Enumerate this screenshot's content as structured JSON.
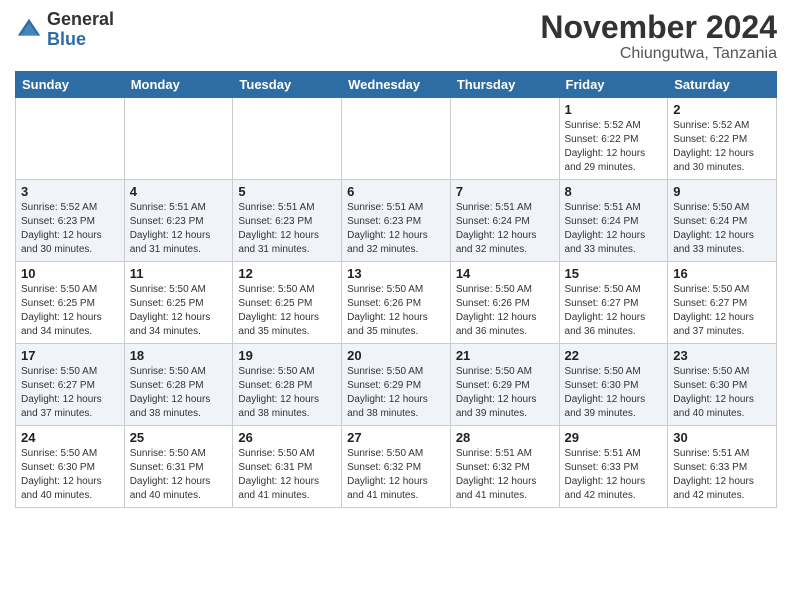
{
  "header": {
    "logo_line1": "General",
    "logo_line2": "Blue",
    "month": "November 2024",
    "location": "Chiungutwa, Tanzania"
  },
  "weekdays": [
    "Sunday",
    "Monday",
    "Tuesday",
    "Wednesday",
    "Thursday",
    "Friday",
    "Saturday"
  ],
  "weeks": [
    [
      {
        "day": "",
        "info": ""
      },
      {
        "day": "",
        "info": ""
      },
      {
        "day": "",
        "info": ""
      },
      {
        "day": "",
        "info": ""
      },
      {
        "day": "",
        "info": ""
      },
      {
        "day": "1",
        "info": "Sunrise: 5:52 AM\nSunset: 6:22 PM\nDaylight: 12 hours\nand 29 minutes."
      },
      {
        "day": "2",
        "info": "Sunrise: 5:52 AM\nSunset: 6:22 PM\nDaylight: 12 hours\nand 30 minutes."
      }
    ],
    [
      {
        "day": "3",
        "info": "Sunrise: 5:52 AM\nSunset: 6:23 PM\nDaylight: 12 hours\nand 30 minutes."
      },
      {
        "day": "4",
        "info": "Sunrise: 5:51 AM\nSunset: 6:23 PM\nDaylight: 12 hours\nand 31 minutes."
      },
      {
        "day": "5",
        "info": "Sunrise: 5:51 AM\nSunset: 6:23 PM\nDaylight: 12 hours\nand 31 minutes."
      },
      {
        "day": "6",
        "info": "Sunrise: 5:51 AM\nSunset: 6:23 PM\nDaylight: 12 hours\nand 32 minutes."
      },
      {
        "day": "7",
        "info": "Sunrise: 5:51 AM\nSunset: 6:24 PM\nDaylight: 12 hours\nand 32 minutes."
      },
      {
        "day": "8",
        "info": "Sunrise: 5:51 AM\nSunset: 6:24 PM\nDaylight: 12 hours\nand 33 minutes."
      },
      {
        "day": "9",
        "info": "Sunrise: 5:50 AM\nSunset: 6:24 PM\nDaylight: 12 hours\nand 33 minutes."
      }
    ],
    [
      {
        "day": "10",
        "info": "Sunrise: 5:50 AM\nSunset: 6:25 PM\nDaylight: 12 hours\nand 34 minutes."
      },
      {
        "day": "11",
        "info": "Sunrise: 5:50 AM\nSunset: 6:25 PM\nDaylight: 12 hours\nand 34 minutes."
      },
      {
        "day": "12",
        "info": "Sunrise: 5:50 AM\nSunset: 6:25 PM\nDaylight: 12 hours\nand 35 minutes."
      },
      {
        "day": "13",
        "info": "Sunrise: 5:50 AM\nSunset: 6:26 PM\nDaylight: 12 hours\nand 35 minutes."
      },
      {
        "day": "14",
        "info": "Sunrise: 5:50 AM\nSunset: 6:26 PM\nDaylight: 12 hours\nand 36 minutes."
      },
      {
        "day": "15",
        "info": "Sunrise: 5:50 AM\nSunset: 6:27 PM\nDaylight: 12 hours\nand 36 minutes."
      },
      {
        "day": "16",
        "info": "Sunrise: 5:50 AM\nSunset: 6:27 PM\nDaylight: 12 hours\nand 37 minutes."
      }
    ],
    [
      {
        "day": "17",
        "info": "Sunrise: 5:50 AM\nSunset: 6:27 PM\nDaylight: 12 hours\nand 37 minutes."
      },
      {
        "day": "18",
        "info": "Sunrise: 5:50 AM\nSunset: 6:28 PM\nDaylight: 12 hours\nand 38 minutes."
      },
      {
        "day": "19",
        "info": "Sunrise: 5:50 AM\nSunset: 6:28 PM\nDaylight: 12 hours\nand 38 minutes."
      },
      {
        "day": "20",
        "info": "Sunrise: 5:50 AM\nSunset: 6:29 PM\nDaylight: 12 hours\nand 38 minutes."
      },
      {
        "day": "21",
        "info": "Sunrise: 5:50 AM\nSunset: 6:29 PM\nDaylight: 12 hours\nand 39 minutes."
      },
      {
        "day": "22",
        "info": "Sunrise: 5:50 AM\nSunset: 6:30 PM\nDaylight: 12 hours\nand 39 minutes."
      },
      {
        "day": "23",
        "info": "Sunrise: 5:50 AM\nSunset: 6:30 PM\nDaylight: 12 hours\nand 40 minutes."
      }
    ],
    [
      {
        "day": "24",
        "info": "Sunrise: 5:50 AM\nSunset: 6:30 PM\nDaylight: 12 hours\nand 40 minutes."
      },
      {
        "day": "25",
        "info": "Sunrise: 5:50 AM\nSunset: 6:31 PM\nDaylight: 12 hours\nand 40 minutes."
      },
      {
        "day": "26",
        "info": "Sunrise: 5:50 AM\nSunset: 6:31 PM\nDaylight: 12 hours\nand 41 minutes."
      },
      {
        "day": "27",
        "info": "Sunrise: 5:50 AM\nSunset: 6:32 PM\nDaylight: 12 hours\nand 41 minutes."
      },
      {
        "day": "28",
        "info": "Sunrise: 5:51 AM\nSunset: 6:32 PM\nDaylight: 12 hours\nand 41 minutes."
      },
      {
        "day": "29",
        "info": "Sunrise: 5:51 AM\nSunset: 6:33 PM\nDaylight: 12 hours\nand 42 minutes."
      },
      {
        "day": "30",
        "info": "Sunrise: 5:51 AM\nSunset: 6:33 PM\nDaylight: 12 hours\nand 42 minutes."
      }
    ]
  ]
}
